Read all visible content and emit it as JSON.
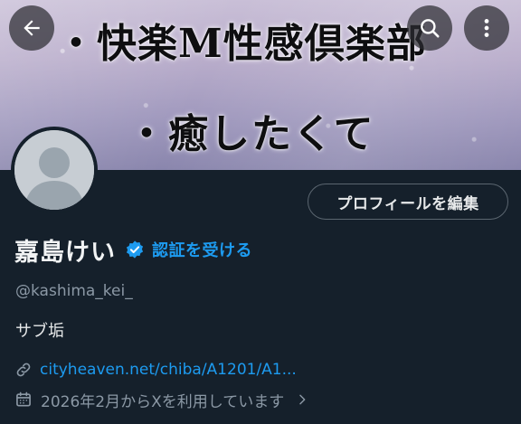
{
  "banner": {
    "line1": "・快楽M性感倶楽部",
    "line2": "・癒したくて"
  },
  "header_icons": [
    "back-arrow-icon",
    "search-icon",
    "more-vertical-icon"
  ],
  "profile": {
    "edit_button_label": "プロフィールを編集",
    "display_name": "嘉島けい",
    "verify_link_label": "認証を受ける",
    "handle": "@kashima_kei_",
    "bio": "サブ垢",
    "website": "cityheaven.net/chiba/A1201/A1...",
    "joined": "2026年2月からXを利用しています"
  },
  "colors": {
    "background": "#15202b",
    "accent": "#1d9bf0",
    "secondary_text": "#8b98a5",
    "primary_text": "#e7e9ea"
  }
}
